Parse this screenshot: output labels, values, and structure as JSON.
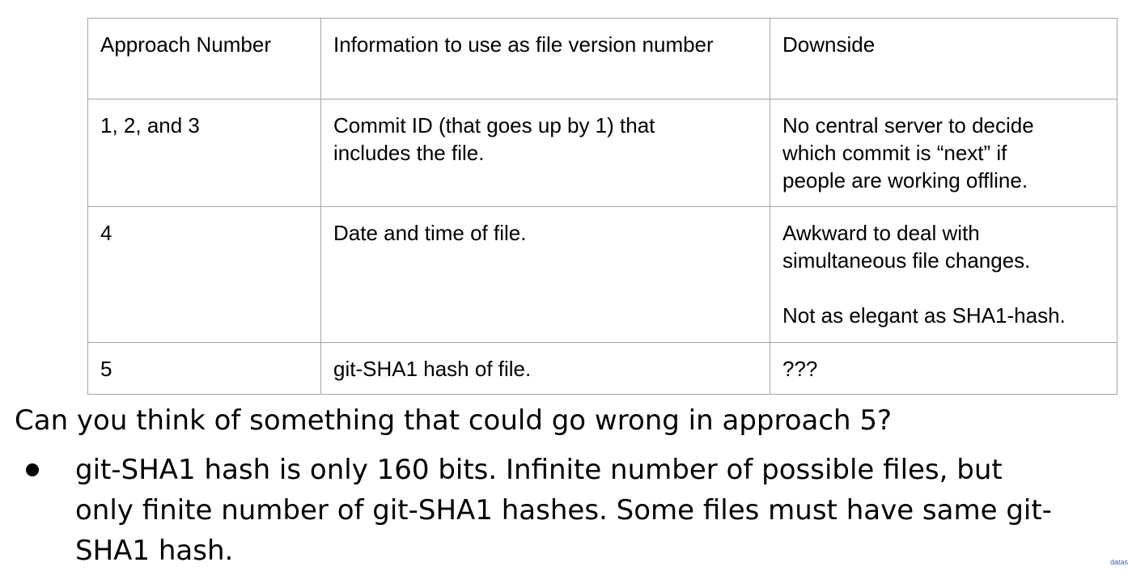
{
  "table": {
    "headers": [
      "Approach Number",
      "Information to use as file version number",
      "Downside"
    ],
    "rows": [
      [
        "1, 2, and 3",
        "Commit ID (that goes up by 1) that\nincludes the file.",
        "No central server to decide\nwhich commit is “next” if\npeople are working offline."
      ],
      [
        "4",
        "Date and time of file.",
        "Awkward to deal with\nsimultaneous file changes.\n\nNot as elegant as SHA1-hash."
      ],
      [
        "5",
        "git-SHA1 hash of file.",
        "???"
      ]
    ]
  },
  "question": "Can you think of something that could go wrong in approach 5?",
  "bullets": [
    "git-SHA1 hash is only 160 bits. Infinite number of possible files, but only finite number of git-SHA1 hashes. Some files must have same git-SHA1 hash."
  ],
  "corner_text": "datas"
}
